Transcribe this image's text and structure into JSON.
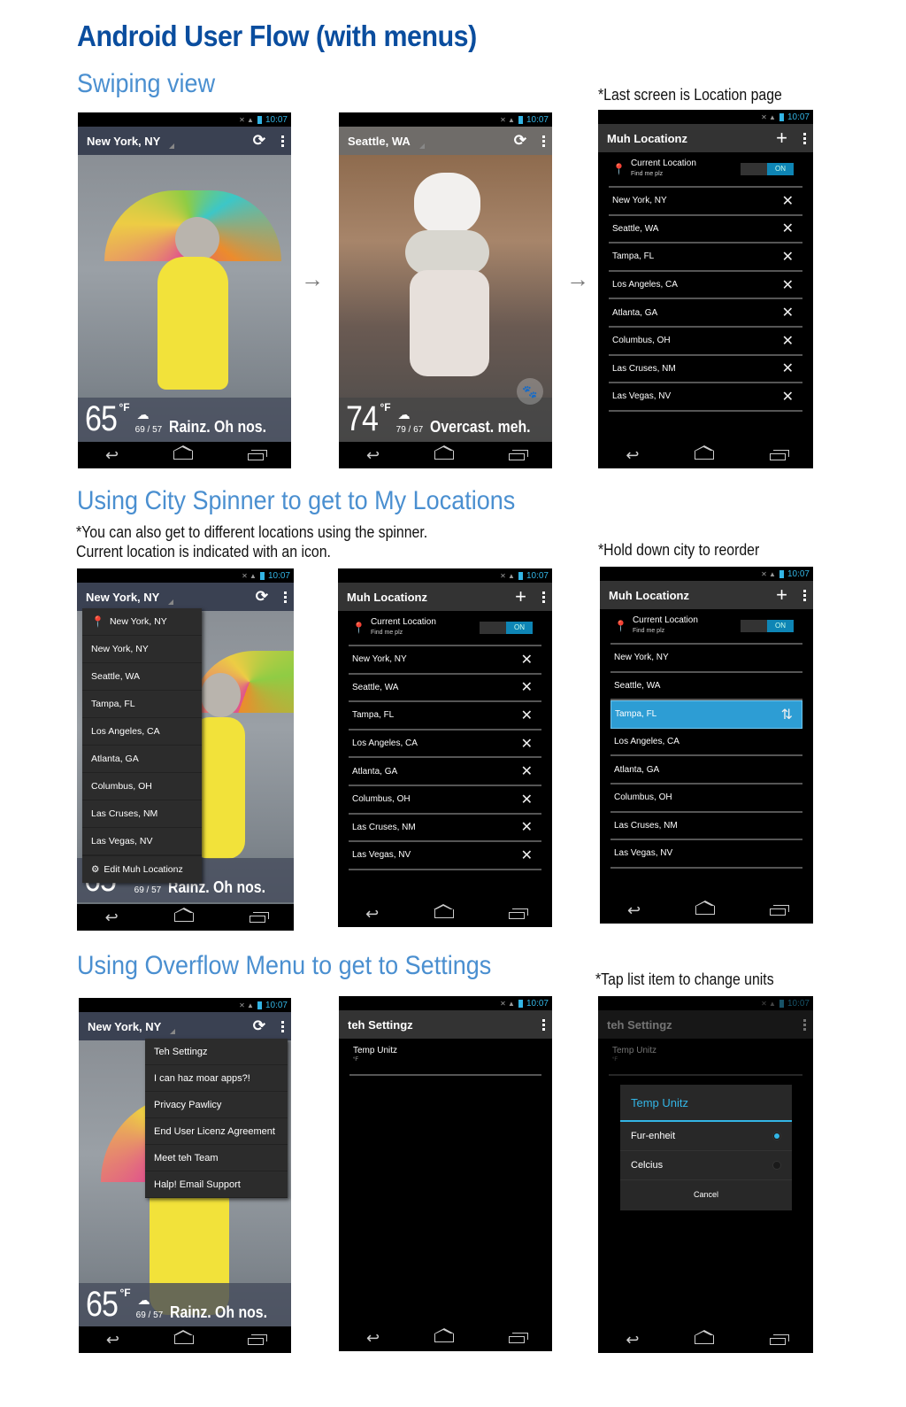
{
  "title": "Android User Flow (with menus)",
  "sections": [
    {
      "heading": "Swiping view",
      "note": "*Last screen is Location page"
    },
    {
      "heading": "Using City Spinner to get to My Locations",
      "note_lines": [
        "*You can also get to different locations using the spinner.",
        "Current location is indicated with an icon."
      ],
      "side_note": "*Hold down city to reorder"
    },
    {
      "heading": "Using Overflow Menu to get to Settings",
      "side_note": "*Tap list item to change units"
    }
  ],
  "status_bar": {
    "time": "10:07"
  },
  "arrow": "→",
  "weather_screens": {
    "ny": {
      "city": "New York, NY",
      "temp": "65",
      "unit": "°F",
      "hilo": "69 / 57",
      "condition": "Rainz. Oh nos.",
      "icon": "rain-cloud-icon"
    },
    "seattle": {
      "city": "Seattle, WA",
      "temp": "74",
      "unit": "°F",
      "hilo": "79 / 67",
      "condition": "Overcast. meh.",
      "icon": "cloud-icon"
    }
  },
  "locations_screen": {
    "title": "Muh Locationz",
    "current_location": {
      "label": "Current Location",
      "sub": "Find me plz",
      "toggle": "ON"
    },
    "cities": [
      "New York, NY",
      "Seattle, WA",
      "Tampa, FL",
      "Los Angeles, CA",
      "Atlanta, GA",
      "Columbus, OH",
      "Las Cruses, NM",
      "Las Vegas, NV"
    ],
    "selected_city_reorder": "Tampa, FL"
  },
  "spinner_menu": {
    "current": "New York, NY",
    "items": [
      "New York, NY",
      "Seattle, WA",
      "Tampa, FL",
      "Los Angeles, CA",
      "Atlanta, GA",
      "Columbus, OH",
      "Las Cruses, NM",
      "Las Vegas, NV"
    ],
    "edit": "Edit Muh Locationz"
  },
  "overflow_menu": {
    "items": [
      "Teh Settingz",
      "I can haz moar apps?!",
      "Privacy Pawlicy",
      "End User Licenz Agreement",
      "Meet teh Team",
      "Halp! Email Support"
    ]
  },
  "settings_screen": {
    "title": "teh Settingz",
    "row_label": "Temp Unitz",
    "row_value": "°F"
  },
  "units_dialog": {
    "title": "Temp Unitz",
    "options": [
      {
        "label": "Fur-enheit",
        "selected": true
      },
      {
        "label": "Celcius",
        "selected": false
      }
    ],
    "cancel": "Cancel"
  },
  "colors": {
    "title": "#0a4d9e",
    "heading": "#4a8fd0",
    "accent": "#33b5e5"
  }
}
